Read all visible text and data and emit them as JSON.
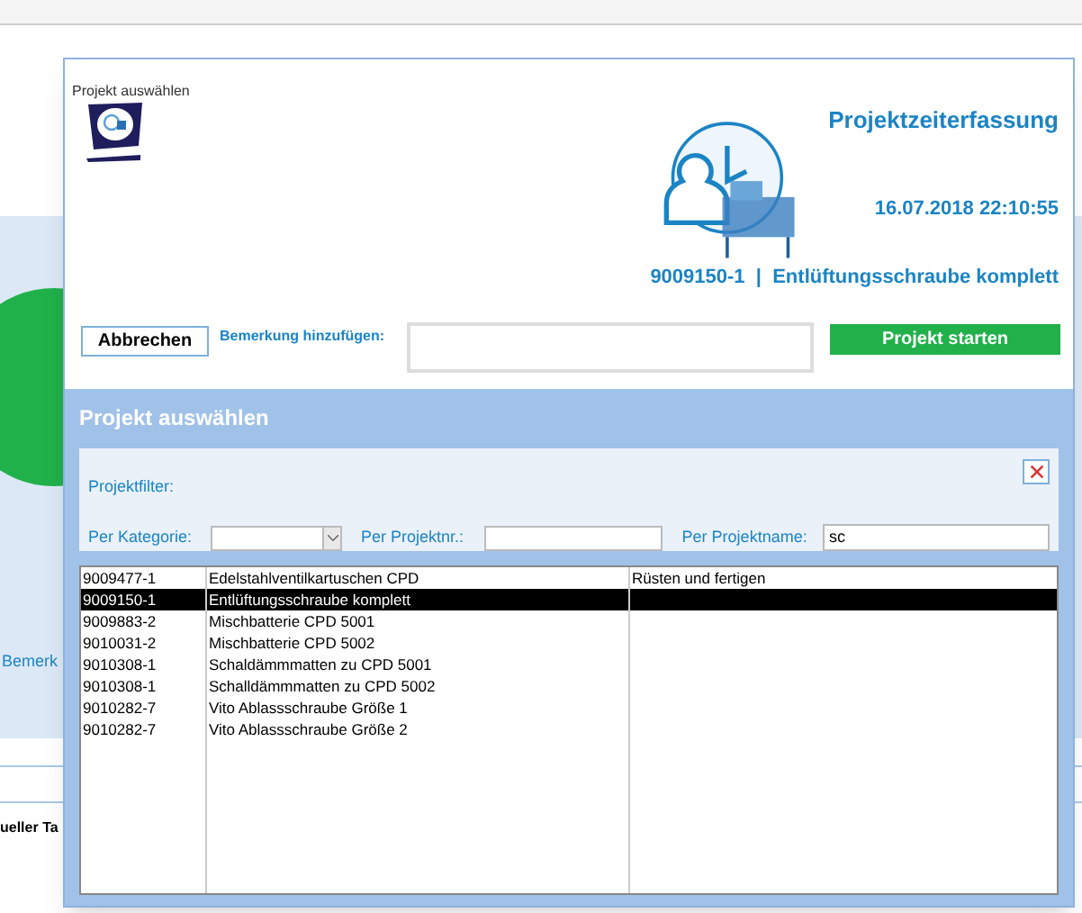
{
  "background": {
    "remark_label": "Bemerk",
    "column_header": "ueller Ta"
  },
  "dialog": {
    "title": "Projekt auswählen",
    "app_title": "Projektzeiterfassung",
    "datetime": "16.07.2018 22:10:55",
    "current_project": "9009150-1  |  Entlüftungsschraube komplett",
    "cancel_button": "Abbrechen",
    "remark_label": "Bemerkung hinzufügen:",
    "start_button": "Projekt starten",
    "section_title": "Projekt auswählen",
    "filter": {
      "label": "Projektfilter:",
      "category_label": "Per Kategorie:",
      "number_label": "Per Projektnr.:",
      "name_label": "Per Projektname:",
      "name_value": "sc"
    },
    "rows": [
      {
        "number": "9009477-1",
        "name": "Edelstahlventilkartuschen CPD",
        "activity": "Rüsten und fertigen",
        "selected": false
      },
      {
        "number": "9009150-1",
        "name": "Entlüftungsschraube komplett",
        "selected": true
      },
      {
        "number": "9009883-2",
        "name": "Mischbatterie CPD 5001",
        "selected": false
      },
      {
        "number": "9010031-2",
        "name": "Mischbatterie CPD 5002",
        "selected": false
      },
      {
        "number": "9010308-1",
        "name": "Schaldämmmatten zu CPD 5001",
        "selected": false
      },
      {
        "number": "9010308-1",
        "name": "Schalldämmmatten zu CPD 5002",
        "selected": false
      },
      {
        "number": "9010282-7",
        "name": "Vito Ablassschraube Größe 1",
        "selected": false
      },
      {
        "number": "9010282-7",
        "name": "Vito Ablassschraube Größe 2",
        "selected": false
      }
    ]
  }
}
